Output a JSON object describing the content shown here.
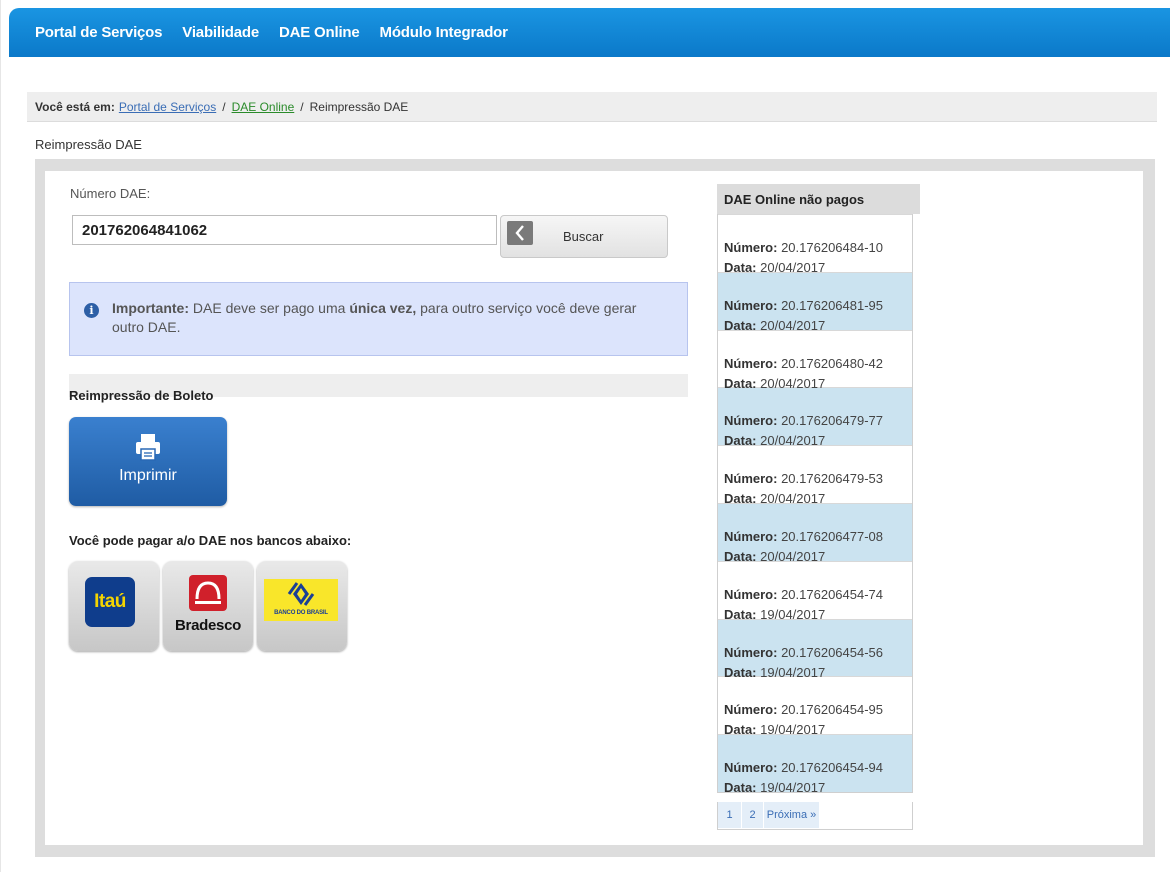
{
  "nav": {
    "items": [
      "Portal de Serviços",
      "Viabilidade",
      "DAE Online",
      "Módulo Integrador"
    ]
  },
  "breadcrumb": {
    "label": "Você está em:",
    "portal": "Portal de Serviços",
    "dae_online": "DAE Online",
    "current": "Reimpressão DAE"
  },
  "page_title": "Reimpressão DAE",
  "search": {
    "label": "Número DAE:",
    "value": "201762064841062",
    "button_label": "Buscar"
  },
  "alert": {
    "lead": "Importante:",
    "text1": "DAE deve ser pago uma",
    "emph": "única vez,",
    "text2": "para outro serviço você deve gerar outro DAE."
  },
  "reprint": {
    "title": "Reimpressão de Boleto",
    "button_label": "Imprimir"
  },
  "banks": {
    "title": "Você pode pagar a/o DAE nos bancos abaixo:",
    "itau": "Itaú",
    "bradesco": "Bradesco",
    "bb": "BANCO DO BRASIL"
  },
  "unpaid": {
    "title": "DAE Online não pagos",
    "numero_label": "Número:",
    "data_label": "Data:",
    "items": [
      {
        "numero": "20.176206484-10",
        "data": "20/04/2017"
      },
      {
        "numero": "20.176206481-95",
        "data": "20/04/2017"
      },
      {
        "numero": "20.176206480-42",
        "data": "20/04/2017"
      },
      {
        "numero": "20.176206479-77",
        "data": "20/04/2017"
      },
      {
        "numero": "20.176206479-53",
        "data": "20/04/2017"
      },
      {
        "numero": "20.176206477-08",
        "data": "20/04/2017"
      },
      {
        "numero": "20.176206454-74",
        "data": "19/04/2017"
      },
      {
        "numero": "20.176206454-56",
        "data": "19/04/2017"
      },
      {
        "numero": "20.176206454-95",
        "data": "19/04/2017"
      },
      {
        "numero": "20.176206454-94",
        "data": "19/04/2017"
      }
    ],
    "pager": {
      "page1": "1",
      "page2": "2",
      "next": "Próxima »"
    }
  },
  "colors": {
    "nav_bg": "#0b79c9",
    "alert_bg": "#dce4fc",
    "row_alt": "#cbe3f0",
    "print_btn": "#1f5ca4"
  }
}
